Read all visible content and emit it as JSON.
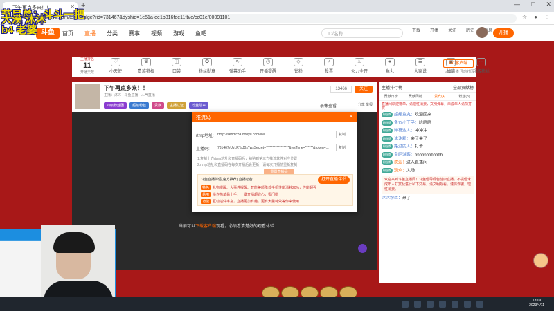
{
  "browser": {
    "tab_title": "下午再点多来！！",
    "url": "douyu.com/topic/yglgc?rid=731467&dyshid=1e51a-ee1b816fee11fb/e/cc01e/00091101",
    "window_controls": [
      "—",
      "□",
      "✕"
    ]
  },
  "overlay": {
    "line1": "节目单：斗斗一把",
    "line2": "大漠  沐沐",
    "line3": "b4  老婆"
  },
  "site_nav": {
    "logo": "斗鱼",
    "items": [
      "首页",
      "直播",
      "分类",
      "赛事",
      "视频",
      "游戏",
      "鱼吧"
    ],
    "active_index": 1,
    "search_placeholder": "ID/名称",
    "right_items": [
      "下载",
      "开播",
      "关注",
      "历史",
      "消息",
      "任务"
    ],
    "live_button": "开播"
  },
  "cat_bar": {
    "rank_label": "主播排名",
    "rank_num": "11",
    "rank_sub": "开播天数",
    "icons": [
      "小天使",
      "贵族特权",
      "口袋",
      "粉丝勋章",
      "弹幕助手",
      "开播提醒",
      "钻粉",
      "投票",
      "火力全开",
      "鱼丸",
      "大家说",
      "抽奖",
      "超级粉丝"
    ],
    "pc_button": "PC客户端",
    "pc_sub": "三屏直播 互动社区"
  },
  "room": {
    "title": "下午再点多来！！",
    "meta": "主播：沐沐 · 斗鱼主播 · 人气直播",
    "tags": [
      "四级粉丝团",
      "超级粉丝",
      "贵族",
      "主播认证",
      "粉丝勋章"
    ],
    "follow_count": "13466",
    "follow_label": "关注",
    "record_link": "录像查看",
    "share_links": "分享  举报"
  },
  "player": {
    "message_prefix": "当前可以",
    "message_highlight": "下载客户端",
    "message_suffix": "观看，必须看清楚好的观看体验"
  },
  "modal": {
    "title": "推流码",
    "close": "✕",
    "rtmp_label": "rtmp地址:",
    "rtmp_value": "rtmp://sendtc3a.douyu.com/live",
    "key_label": "直播码:",
    "key_value": "731467rUvLRTaJ0s?wsSecret=*****************&wsTime=******&token=...",
    "copy_label": "复制",
    "tip1": "1.复制上方rtmp地址和直播码后，粘贴到第三方推流软件对应位置",
    "tip2": "2.rtmp地址和直播码在每次开播后会更新，请每次开播前重新复制",
    "reset_label": "重置直播码",
    "tool_title": "斗鱼直播伴侣(官方推荐)  直播必备",
    "tool_open": "打开直播伴侣",
    "tool_lines": [
      {
        "tag": "特色",
        "text": "礼物提醒、大事件提醒、智能美颜降低手机性能消耗20%，性能超强"
      },
      {
        "tag": "易用",
        "text": "操作简单易上手，一键开播超省心，零门槛"
      },
      {
        "tag": "功能",
        "text": "互动插件丰富，直播更加有趣，更有大量特效等你来使用"
      }
    ]
  },
  "right_panel": {
    "head_left": "主播排行榜",
    "head_right": "全部贡献榜",
    "tabs": [
      "贡献日榜",
      "贡献周榜",
      "贵宾(4)",
      "粉丝(3)"
    ],
    "banner": "直播间欢迎榜单，请理性消费，文明弹幕，未成年人请勿打赏",
    "chat": [
      {
        "badge": "粉丝牌",
        "user": "超级鱼丸：",
        "text": "欢迎回来"
      },
      {
        "badge": "粉丝牌",
        "user": "鱼丸小王子：",
        "text": "哈哈哈"
      },
      {
        "badge": "粉丝牌",
        "user": "弹幕达人：",
        "text": "冲冲冲"
      },
      {
        "badge": "粉丝牌",
        "user": "沐沐粉：",
        "text": "来了来了"
      },
      {
        "badge": "粉丝牌",
        "user": "路过的人：",
        "text": "打卡"
      },
      {
        "badge": "粉丝牌",
        "user": "鱼吧游客：",
        "text": "666666666666"
      },
      {
        "badge": "粉丝牌",
        "user": "欢迎：",
        "text": "进入直播间"
      },
      {
        "badge": "粉丝牌",
        "user": "观众：",
        "text": "入场"
      }
    ],
    "notice": "欢迎来到斗鱼直播间！斗鱼倡导绿色健康直播，不提倡未成年人打赏及进行私下交易，请文明观看，谨防诈骗，理性消费。",
    "chat_tail": {
      "user": "沐沐粉丝：",
      "text": "来了"
    }
  },
  "taskbar": {
    "time": "13:09",
    "date": "2023/4/11"
  }
}
